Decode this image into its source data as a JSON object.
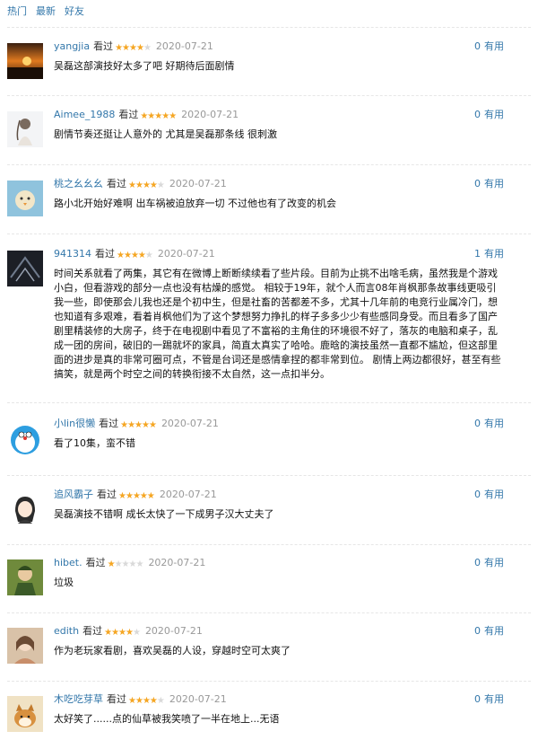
{
  "tabs": [
    "热门",
    "最新",
    "好友"
  ],
  "comments": [
    {
      "user": "yangjia",
      "action": "看过",
      "rating": 4,
      "date": "2020-07-21",
      "useful_count": "0",
      "useful_label": "有用",
      "text": "吴磊这部演技好太多了吧 好期待后面剧情",
      "avatar": "sunset-avatar"
    },
    {
      "user": "Aimee_1988",
      "action": "看过",
      "rating": 5,
      "date": "2020-07-21",
      "useful_count": "0",
      "useful_label": "有用",
      "text": "剧情节奏还挺让人意外的 尤其是吴磊那条线 很刺激",
      "avatar": "girl-sketch-avatar"
    },
    {
      "user": "桃之幺幺幺",
      "action": "看过",
      "rating": 4,
      "date": "2020-07-21",
      "useful_count": "0",
      "useful_label": "有用",
      "text": "路小北开始好难啊 出车祸被迫放弃一切 不过他也有了改变的机会",
      "avatar": "cartoon-bird-avatar"
    },
    {
      "user": "941314",
      "action": "看过",
      "rating": 4,
      "date": "2020-07-21",
      "useful_count": "1",
      "useful_label": "有用",
      "text": "时间关系就看了两集，其它有在微博上断断续续看了些片段。目前为止挑不出啥毛病，虽然我是个游戏小白，但看游戏的部分一点也没有枯燥的感觉。 相较于19年，就个人而言08年肖枫那条故事线更吸引我一些，即使那会儿我也还是个初中生，但是社畜的苦都差不多，尤其十几年前的电竞行业属冷门，想也知道有多艰难，看着肖枫他们为了这个梦想努力挣扎的样子多多少少有些感同身受。而且看多了国产剧里精装修的大房子，终于在电视剧中看见了不富裕的主角住的环境很不好了，落灰的电脑和桌子，乱成一团的房间，破旧的一踢就坏的家具，简直太真实了哈哈。鹿晗的演技虽然一直都不尴尬，但这部里面的进步是真的非常可圈可点，不管是台词还是感情拿捏的都非常到位。 剧情上两边都很好，甚至有些搞笑，就是两个时空之间的转换衔接不太自然，这一点扣半分。",
      "avatar": "dark-pattern-avatar"
    },
    {
      "user": "小lin很懒",
      "action": "看过",
      "rating": 5,
      "date": "2020-07-21",
      "useful_count": "0",
      "useful_label": "有用",
      "text": "看了10集，蛮不错",
      "avatar": "doraemon-avatar"
    },
    {
      "user": "追风霸子",
      "action": "看过",
      "rating": 5,
      "date": "2020-07-21",
      "useful_count": "0",
      "useful_label": "有用",
      "text": "吴磊演技不错啊 成长太快了一下成男子汉大丈夫了",
      "avatar": "anime-girl-avatar"
    },
    {
      "user": "hibet.",
      "action": "看过",
      "rating": 1,
      "date": "2020-07-21",
      "useful_count": "0",
      "useful_label": "有用",
      "text": "垃圾",
      "avatar": "anime-character-avatar"
    },
    {
      "user": "edith",
      "action": "看过",
      "rating": 4,
      "date": "2020-07-21",
      "useful_count": "0",
      "useful_label": "有用",
      "text": "作为老玩家看剧，喜欢吴磊的人设，穿越时空可太爽了",
      "avatar": "girl-photo-avatar"
    },
    {
      "user": "木吃吃芽草",
      "action": "看过",
      "rating": 4,
      "date": "2020-07-21",
      "useful_count": "0",
      "useful_label": "有用",
      "text": "太好笑了......点的仙草被我笑喷了一半在地上...无语",
      "avatar": "shiba-dog-avatar"
    }
  ],
  "colors": {
    "link": "#3377aa",
    "star": "#f5a623",
    "star_empty": "#d9d9d9",
    "date": "#999999"
  }
}
